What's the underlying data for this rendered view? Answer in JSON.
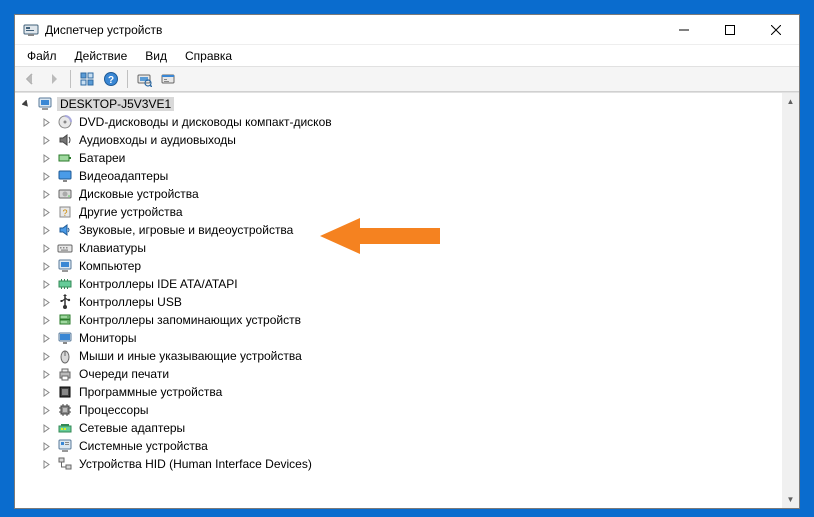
{
  "window": {
    "title": "Диспетчер устройств"
  },
  "menubar": {
    "file": "Файл",
    "action": "Действие",
    "view": "Вид",
    "help": "Справка"
  },
  "tree": {
    "root": "DESKTOP-J5V3VE1",
    "items": [
      "DVD-дисководы и дисководы компакт-дисков",
      "Аудиовходы и аудиовыходы",
      "Батареи",
      "Видеоадаптеры",
      "Дисковые устройства",
      "Другие устройства",
      "Звуковые, игровые и видеоустройства",
      "Клавиатуры",
      "Компьютер",
      "Контроллеры IDE ATA/ATAPI",
      "Контроллеры USB",
      "Контроллеры запоминающих устройств",
      "Мониторы",
      "Мыши и иные указывающие устройства",
      "Очереди печати",
      "Программные устройства",
      "Процессоры",
      "Сетевые адаптеры",
      "Системные устройства",
      "Устройства HID (Human Interface Devices)"
    ]
  }
}
